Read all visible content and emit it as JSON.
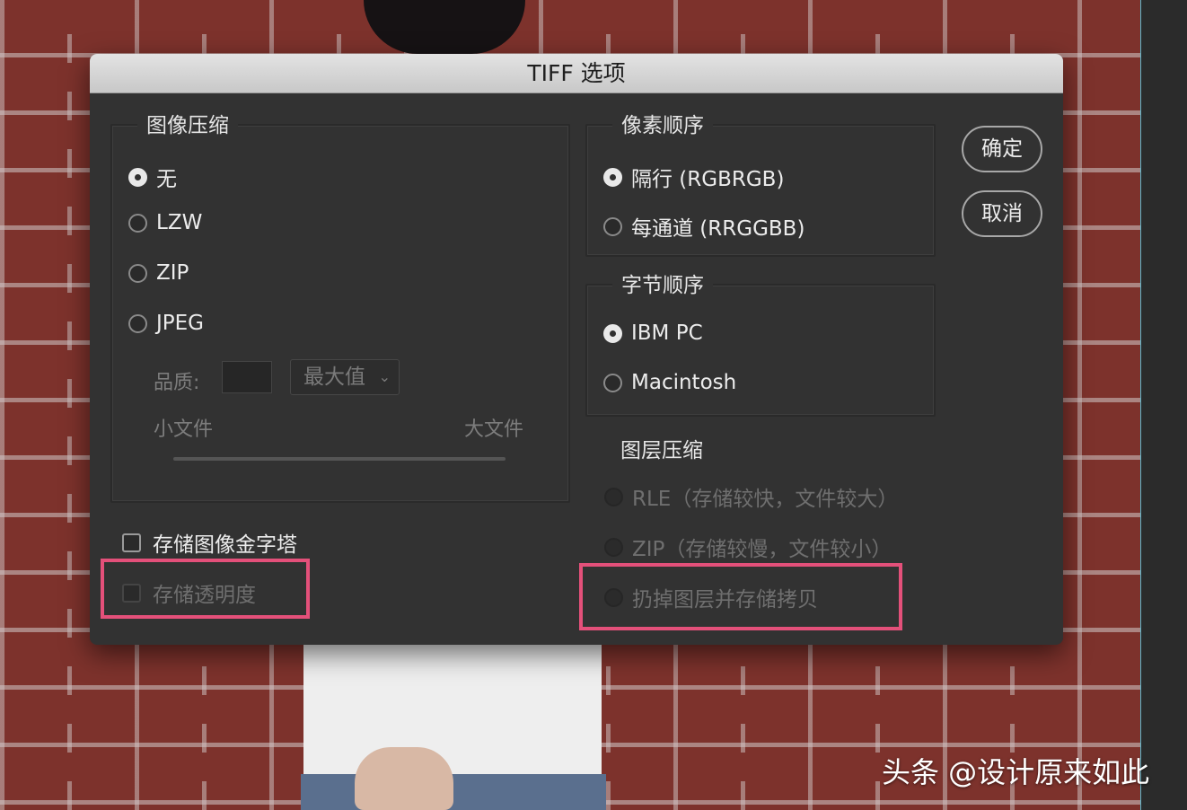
{
  "dialog": {
    "title": "TIFF 选项",
    "ok_label": "确定",
    "cancel_label": "取消"
  },
  "image_compression": {
    "legend": "图像压缩",
    "options": [
      {
        "label": "无",
        "checked": true
      },
      {
        "label": "LZW",
        "checked": false
      },
      {
        "label": "ZIP",
        "checked": false
      },
      {
        "label": "JPEG",
        "checked": false
      }
    ],
    "quality_label": "品质:",
    "quality_value": "",
    "quality_select": "最大值",
    "small_file": "小文件",
    "large_file": "大文件"
  },
  "pixel_order": {
    "legend": "像素顺序",
    "options": [
      {
        "label": "隔行 (RGBRGB)",
        "checked": true
      },
      {
        "label": "每通道 (RRGGBB)",
        "checked": false
      }
    ]
  },
  "byte_order": {
    "legend": "字节顺序",
    "options": [
      {
        "label": "IBM PC",
        "checked": true
      },
      {
        "label": "Macintosh",
        "checked": false
      }
    ]
  },
  "layer_compression": {
    "legend": "图层压缩",
    "options": [
      {
        "label": "RLE（存储较快，文件较大）",
        "disabled": true
      },
      {
        "label": "ZIP（存储较慢，文件较小）",
        "disabled": true
      },
      {
        "label": "扔掉图层并存储拷贝",
        "disabled": true
      }
    ]
  },
  "checkboxes": {
    "save_pyramid": "存储图像金字塔",
    "save_transparency": "存储透明度"
  },
  "watermark": "头条 @设计原来如此",
  "colors": {
    "dialog_bg": "#323232",
    "highlight": "#e4507a",
    "brick": "#7d322c"
  }
}
